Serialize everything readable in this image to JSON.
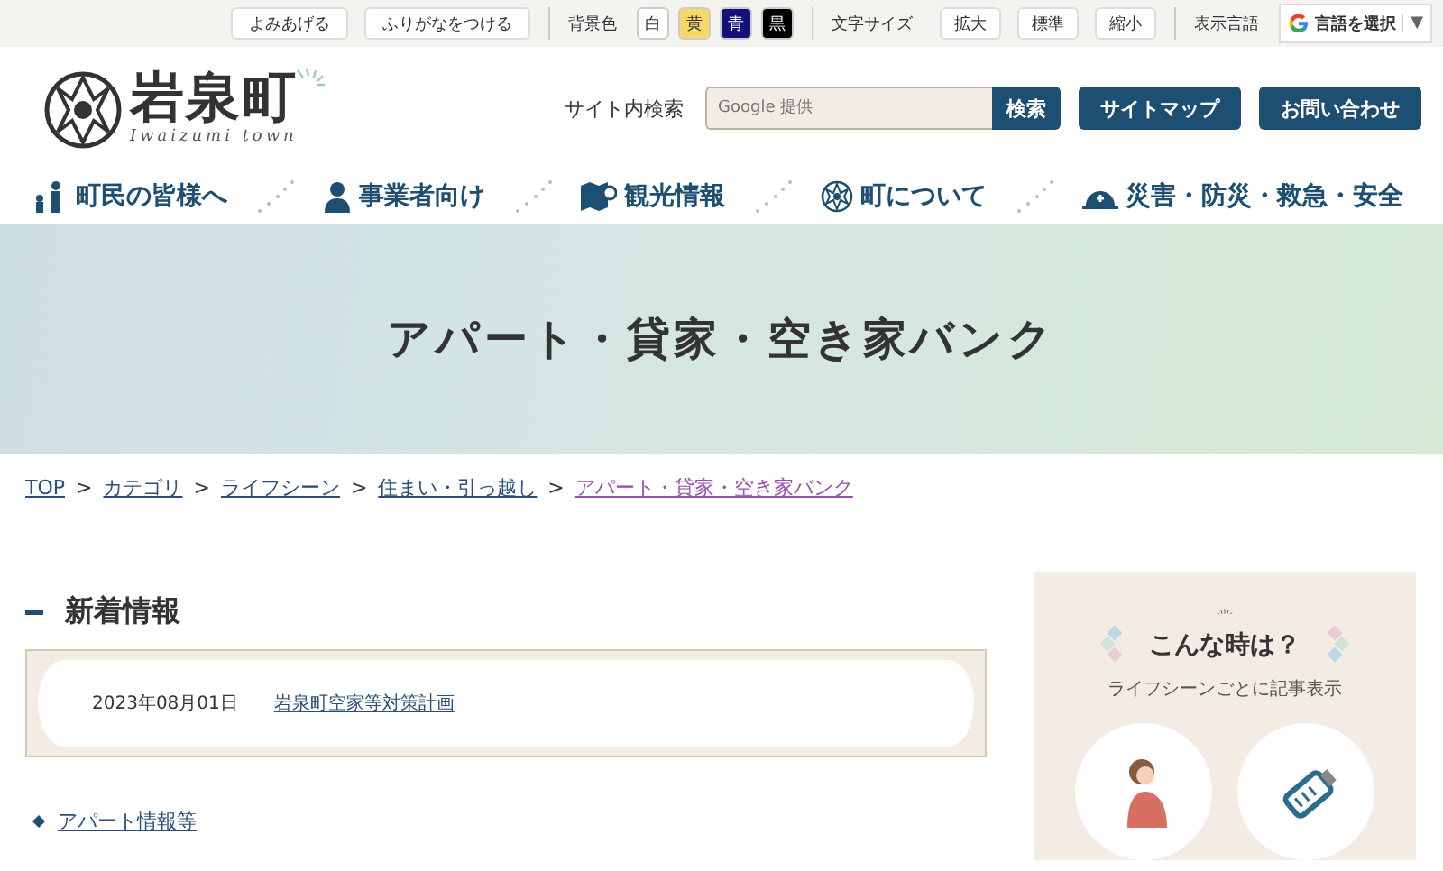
{
  "utility_bar": {
    "buttons": [
      "よみあげる",
      "ふりがなをつける"
    ],
    "bg_label": "背景色",
    "bg_colors": [
      {
        "label": "白",
        "color": "#ffffff"
      },
      {
        "label": "黄",
        "color": "#f7d766"
      },
      {
        "label": "青",
        "color": "#12127a"
      },
      {
        "label": "黒",
        "color": "#000000"
      }
    ],
    "font_label": "文字サイズ",
    "font_buttons": [
      "拡大",
      "標準",
      "縮小"
    ],
    "lang_label": "表示言語",
    "translate": {
      "label": "言語を選択",
      "caret": "▼"
    }
  },
  "header": {
    "logo": {
      "title": "岩泉町",
      "subtitle": "Iwaizumi town"
    },
    "search_label": "サイト内検索",
    "search": {
      "placeholder": "Google 提供"
    },
    "search_button": "検索",
    "links": [
      "サイトマップ",
      "お問い合わせ"
    ]
  },
  "nav": [
    {
      "label": "町民の皆様へ",
      "kind": "people"
    },
    {
      "label": "事業者向け",
      "kind": "worker"
    },
    {
      "label": "観光情報",
      "kind": "map"
    },
    {
      "label": "町について",
      "kind": "emblem"
    },
    {
      "label": "災害・防災・救急・安全",
      "kind": "helmet"
    }
  ],
  "page_title": "アパート・貸家・空き家バンク",
  "breadcrumb": [
    {
      "label": "TOP",
      "visited": false
    },
    {
      "separator": ">",
      "label": "カテゴリ",
      "visited": false
    },
    {
      "separator": ">",
      "label": "ライフシーン",
      "visited": false
    },
    {
      "separator": ">",
      "label": "住まい・引っ越し",
      "visited": false
    },
    {
      "separator": ">",
      "label": "アパート・貸家・空き家バンク",
      "visited": true
    }
  ],
  "news": {
    "heading": "新着情報",
    "items": [
      {
        "date": "2023年08月01日",
        "title": "岩泉町空家等対策計画"
      }
    ]
  },
  "links": [
    "アパート情報等"
  ],
  "sidebar": {
    "title": "こんな時は？",
    "subtitle": "ライフシーンごとに記事表示"
  }
}
